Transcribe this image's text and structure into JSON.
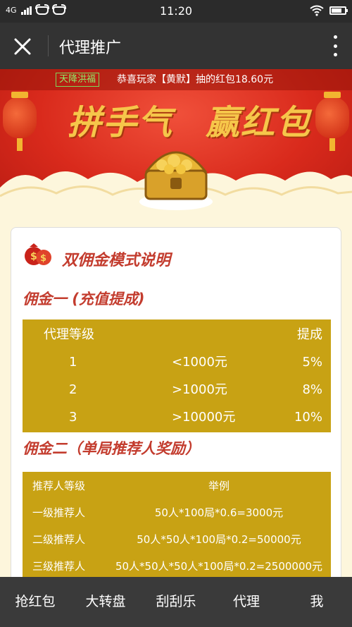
{
  "status_bar": {
    "network": "4G",
    "time": "11:20"
  },
  "nav": {
    "title": "代理推广"
  },
  "banner": {
    "tag": "天降洪福",
    "ticker": "恭喜玩家【黄默】抽的红包18.60元",
    "slogan_left": "拼手气",
    "slogan_right": "赢红包"
  },
  "card": {
    "title": "双佣金模式说明",
    "section1_title": "佣金一 (充值提成)",
    "table1": {
      "headers": [
        "代理等级",
        "",
        "提成"
      ],
      "rows": [
        [
          "1",
          "<1000元",
          "5%"
        ],
        [
          "2",
          ">1000元",
          "8%"
        ],
        [
          "3",
          ">10000元",
          "10%"
        ]
      ]
    },
    "section2_title": "佣金二（单局推荐人奖励）",
    "table2": {
      "headers": [
        "推荐人等级",
        "举例"
      ],
      "rows": [
        [
          "一级推荐人",
          "50人*100局*0.6=3000元"
        ],
        [
          "二级推荐人",
          "50人*50人*100局*0.2=50000元"
        ],
        [
          "三级推荐人",
          "50人*50人*50人*100局*0.2=2500000元"
        ]
      ]
    }
  },
  "tabs": [
    "抢红包",
    "大转盘",
    "刮刮乐",
    "代理",
    "我"
  ],
  "colors": {
    "accent_red": "#c33c2e",
    "table_gold": "#c8a214",
    "bar_dark": "#333333"
  }
}
